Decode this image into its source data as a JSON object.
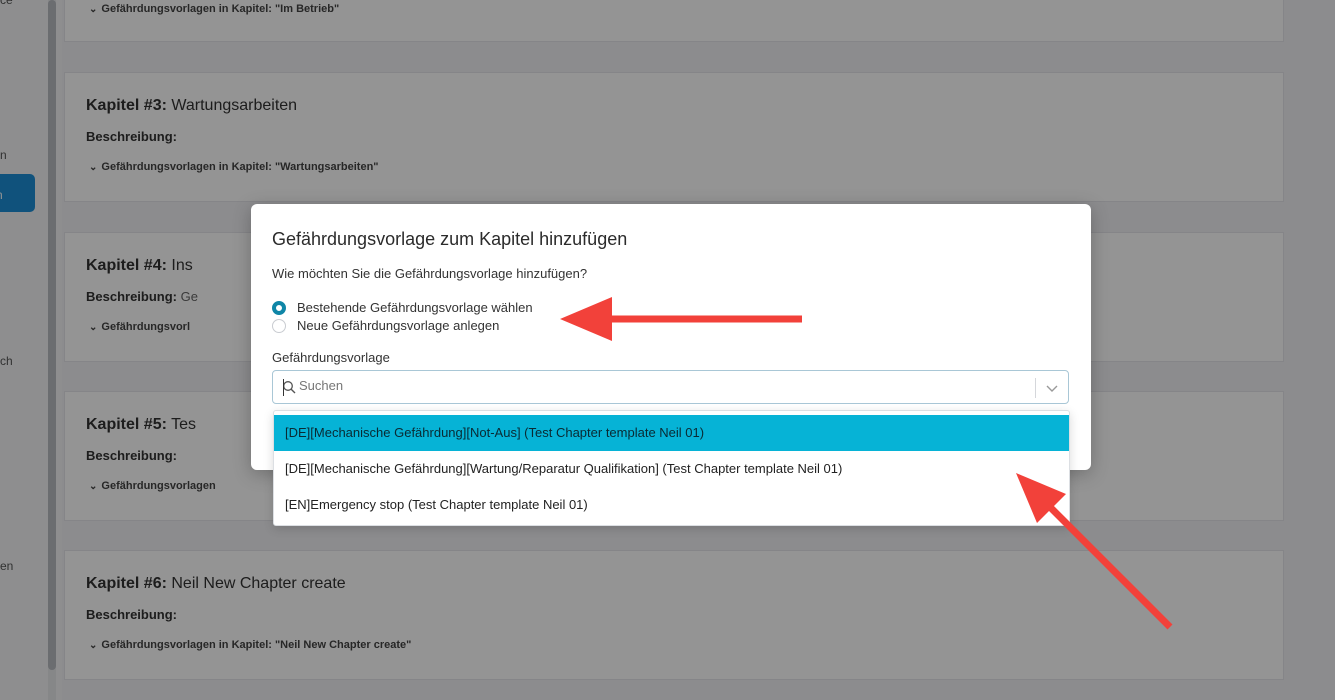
{
  "sidebar": {
    "fragments": [
      "ce",
      "n",
      "n",
      "ch",
      "en"
    ]
  },
  "chapters": [
    {
      "subtitle": "Gefährdungsvorlagen in Kapitel: \"Im Betrieb\""
    },
    {
      "number": "Kapitel #3:",
      "name": "Wartungsarbeiten",
      "desc_label": "Beschreibung:",
      "desc_value": "",
      "subtitle": "Gefährdungsvorlagen in Kapitel: \"Wartungsarbeiten\""
    },
    {
      "number": "Kapitel #4:",
      "name": "Ins",
      "desc_label": "Beschreibung:",
      "desc_value": "Ge",
      "subtitle": "Gefährdungsvorl"
    },
    {
      "number": "Kapitel #5:",
      "name": "Tes",
      "desc_label": "Beschreibung:",
      "desc_value": "",
      "subtitle": "Gefährdungsvorlagen"
    },
    {
      "number": "Kapitel #6:",
      "name": "Neil New Chapter create",
      "desc_label": "Beschreibung:",
      "desc_value": "",
      "subtitle": "Gefährdungsvorlagen in Kapitel: \"Neil New Chapter create\""
    }
  ],
  "modal": {
    "title": "Gefährdungsvorlage zum Kapitel hinzufügen",
    "question": "Wie möchten Sie die Gefährdungsvorlage hinzufügen?",
    "radio_options": [
      {
        "label": "Bestehende Gefährdungsvorlage wählen",
        "checked": true
      },
      {
        "label": "Neue Gefährdungsvorlage anlegen",
        "checked": false
      }
    ],
    "field_label": "Gefährdungsvorlage",
    "search_placeholder": "Suchen",
    "search_value": ""
  },
  "dropdown": {
    "options": [
      "[DE][Mechanische Gefährdung][Not-Aus] (Test Chapter template Neil 01)",
      "[DE][Mechanische Gefährdung][Wartung/Reparatur Qualifikation] (Test Chapter template Neil 01)",
      "[EN]Emergency stop (Test Chapter template Neil 01)"
    ],
    "highlighted_index": 0
  },
  "colors": {
    "accent": "#0f86a7",
    "highlight": "#06b3d6",
    "annotation_arrow": "#f2413a"
  },
  "icons": {
    "search": "search-icon",
    "dropdown": "chevron-down-icon",
    "sort": "sort-icon"
  }
}
